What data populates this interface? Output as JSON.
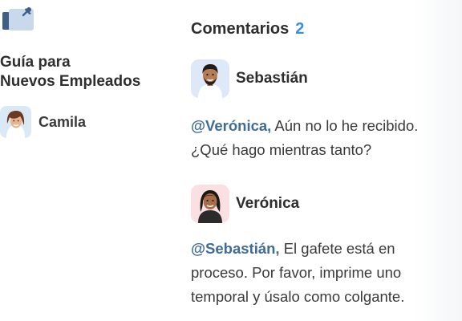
{
  "document": {
    "icon": "pin-folder-icon",
    "title_line1": "Guía para",
    "title_line2": "Nuevos Empleados",
    "author": "Camila"
  },
  "comments_panel": {
    "title": "Comentarios",
    "count": "2",
    "items": [
      {
        "author": "Sebastián",
        "mention": "@Verónica,",
        "text_line1": " Aún no lo he recibido.",
        "text_line2": "¿Qué hago mientras tanto?"
      },
      {
        "author": "Verónica",
        "mention": "@Sebastián,",
        "text_line1": " El gafete está en",
        "text_line2": "proceso. Por favor, imprime uno",
        "text_line3": "temporal y úsalo como colgante."
      }
    ]
  },
  "colors": {
    "accent": "#3a8fe0",
    "mention": "#3f6b95",
    "text": "#2e2e2e"
  }
}
